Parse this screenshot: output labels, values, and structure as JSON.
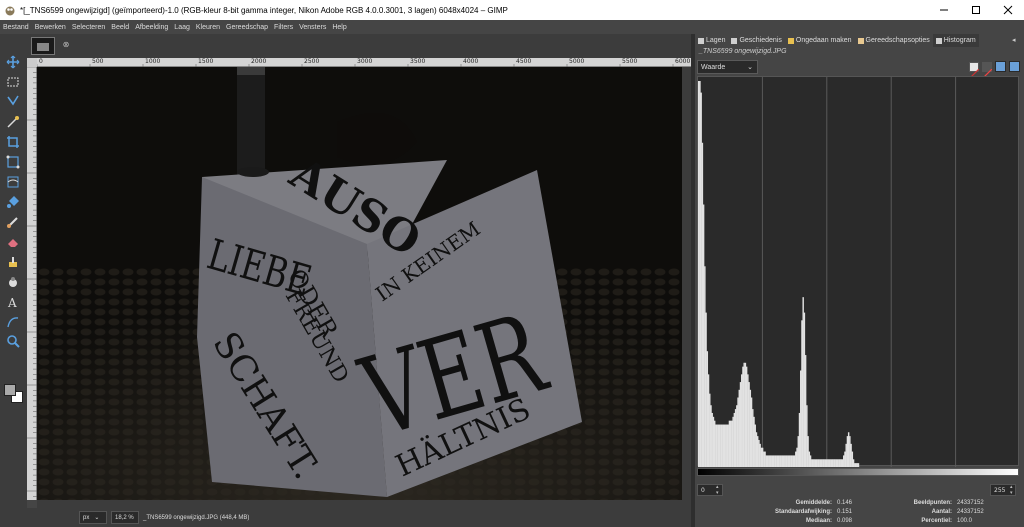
{
  "window": {
    "title": "*[_TNS6599 ongewijzigd] (geïmporteerd)-1.0 (RGB-kleur 8-bit gamma integer, Nikon Adobe RGB 4.0.0.3001, 3 lagen) 6048x4024 – GIMP",
    "icons": {
      "app": "gimp-icon",
      "minimize": "minimize-icon",
      "maximize": "maximize-icon",
      "close": "close-icon"
    }
  },
  "menu": [
    "Bestand",
    "Bewerken",
    "Selecteren",
    "Beeld",
    "Afbeelding",
    "Laag",
    "Kleuren",
    "Gereedschap",
    "Filters",
    "Vensters",
    "Help"
  ],
  "toolbox": {
    "tools": [
      "move-tool-icon",
      "rect-select-icon",
      "free-select-icon",
      "fuzzy-select-icon",
      "crop-icon",
      "unified-transform-icon",
      "warp-transform-icon",
      "bucket-fill-icon",
      "paintbrush-icon",
      "eraser-icon",
      "clone-icon",
      "smudge-icon",
      "ink-icon",
      "text-icon",
      "path-icon",
      "zoom-icon"
    ],
    "foreground_color": "#aaaaaa",
    "background_color": "#ffffff"
  },
  "ruler": {
    "top_labels": [
      "0",
      "500",
      "1000",
      "1500",
      "2000",
      "2500",
      "3000",
      "3500",
      "4000",
      "4500",
      "5000",
      "5500",
      "6000"
    ]
  },
  "canvas": {
    "words": {
      "top": "AUSO",
      "left_1": "LIEBE",
      "left_2": "ODER",
      "left_3": "FREUND",
      "left_4": "SCHAFT.",
      "right_1": "IN KEINEM",
      "right_2": "VER",
      "right_3": "HÄLTNIS"
    }
  },
  "status": {
    "unit": "px",
    "zoom": "18,2 %",
    "file": "_TNS6599 ongewijzigd.JPG (448,4 MB)"
  },
  "dock": {
    "tabs": [
      "Lagen",
      "Geschiedenis",
      "Ongedaan maken",
      "Gereedschapsopties",
      "Histogram"
    ],
    "active_tab": "Histogram",
    "doc_name": "_TNS6599 ongewijzigd.JPG",
    "channel": "Waarde",
    "range_low": "0",
    "range_high": "255",
    "stats": {
      "left": [
        {
          "label": "Gemiddelde:",
          "value": "0.146"
        },
        {
          "label": "Standaardafwijking:",
          "value": "0.151"
        },
        {
          "label": "Mediaan:",
          "value": "0.098"
        }
      ],
      "right": [
        {
          "label": "Beeldpunten:",
          "value": "24337152"
        },
        {
          "label": "Aantal:",
          "value": "24337152"
        },
        {
          "label": "Percentiel:",
          "value": "100.0"
        }
      ]
    }
  },
  "histogram": {
    "x_range": [
      0,
      255
    ],
    "bins": [
      100,
      100,
      97,
      84,
      68,
      52,
      40,
      30,
      24,
      19,
      16,
      14,
      13,
      12,
      11,
      11,
      11,
      11,
      11,
      11,
      11,
      11,
      11,
      11,
      11,
      12,
      12,
      12,
      13,
      14,
      15,
      16,
      18,
      20,
      22,
      24,
      26,
      27,
      27,
      26,
      24,
      22,
      20,
      18,
      15,
      13,
      11,
      9,
      8,
      7,
      6,
      5,
      5,
      4,
      4,
      3,
      3,
      3,
      3,
      3,
      3,
      3,
      3,
      3,
      3,
      3,
      3,
      3,
      3,
      3,
      3,
      3,
      3,
      3,
      3,
      3,
      3,
      3,
      3,
      4,
      5,
      8,
      14,
      25,
      38,
      44,
      40,
      29,
      16,
      8,
      4,
      3,
      2,
      2,
      2,
      2,
      2,
      2,
      2,
      2,
      2,
      2,
      2,
      2,
      2,
      2,
      2,
      2,
      2,
      2,
      2,
      2,
      2,
      2,
      2,
      2,
      2,
      2,
      3,
      4,
      6,
      8,
      9,
      8,
      6,
      4,
      2,
      1,
      1,
      1,
      1,
      0,
      0,
      0,
      0,
      0,
      0,
      0,
      0,
      0,
      0,
      0,
      0,
      0,
      0,
      0,
      0,
      0,
      0,
      0,
      0,
      0,
      0,
      0,
      0,
      0,
      0,
      0,
      0,
      0,
      0,
      0,
      0,
      0,
      0,
      0,
      0,
      0,
      0,
      0,
      0,
      0,
      0,
      0,
      0,
      0,
      0,
      0,
      0,
      0,
      0,
      0,
      0,
      0,
      0,
      0,
      0,
      0,
      0,
      0,
      0,
      0,
      0,
      0,
      0,
      0,
      0,
      0,
      0,
      0,
      0,
      0,
      0,
      0,
      0,
      0,
      0,
      0,
      0,
      0,
      0,
      0,
      0,
      0,
      0,
      0,
      0,
      0,
      0,
      0,
      0,
      0,
      0,
      0,
      0,
      0,
      0,
      0,
      0,
      0,
      0,
      0,
      0,
      0,
      0,
      0,
      0,
      0,
      0,
      0,
      0,
      0,
      0,
      0,
      0,
      0,
      0,
      0,
      0,
      0,
      0,
      0,
      0,
      0,
      0,
      0,
      0,
      0,
      0,
      0,
      0,
      0
    ]
  }
}
